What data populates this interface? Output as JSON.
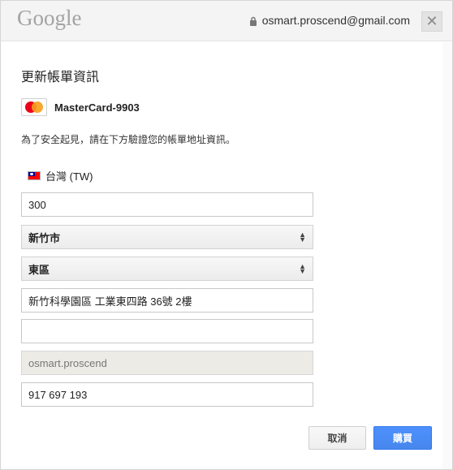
{
  "header": {
    "logo_text": "Google",
    "account_email": "osmart.proscend@gmail.com",
    "close_label": "✕"
  },
  "title": "更新帳單資訊",
  "card": {
    "logo_text": "MasterCard",
    "name": "MasterCard-9903"
  },
  "verify_text": "為了安全起見，請在下方驗證您的帳單地址資訊。",
  "country": {
    "label": "台灣 (TW)"
  },
  "fields": {
    "postal_code": "300",
    "city": "新竹市",
    "district": "東區",
    "address_line1": "新竹科學園區 工業東四路 36號 2樓",
    "address_line2": "",
    "name": "osmart.proscend",
    "phone": "917 697 193"
  },
  "buttons": {
    "cancel": "取消",
    "buy": "購買"
  },
  "colors": {
    "primary_button": "#4d90fe",
    "header_bg": "#f4f4f4"
  }
}
